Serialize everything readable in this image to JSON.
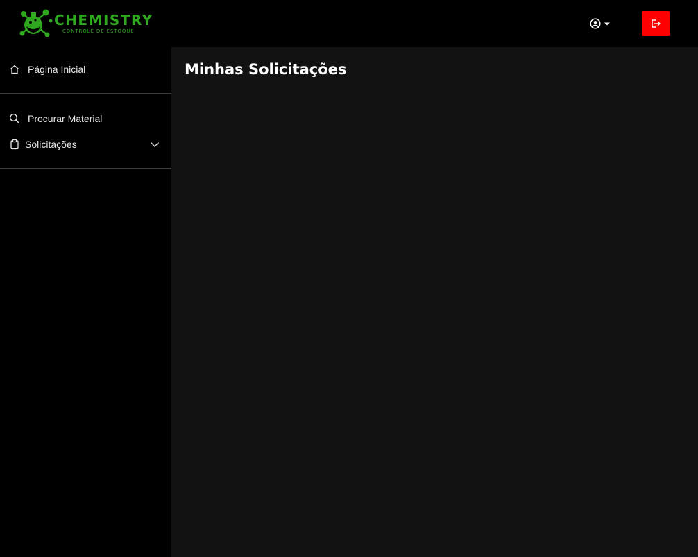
{
  "brand": {
    "title": "CHEMISTRY",
    "subtitle": "CONTROLE DE ESTOQUE",
    "icon": "flask-molecule-logo",
    "color": "#2fa820"
  },
  "header": {
    "user_menu_icon": "user-circle-icon",
    "logout_icon": "logout-icon",
    "logout_color": "#ff0000"
  },
  "sidebar": {
    "items": [
      {
        "label": "Página Inicial",
        "icon": "home-icon"
      },
      {
        "label": "Procurar Material",
        "icon": "search-icon"
      },
      {
        "label": "Solicitações",
        "icon": "clipboard-icon",
        "expandable": true
      }
    ]
  },
  "main": {
    "title": "Minhas Solicitações"
  }
}
